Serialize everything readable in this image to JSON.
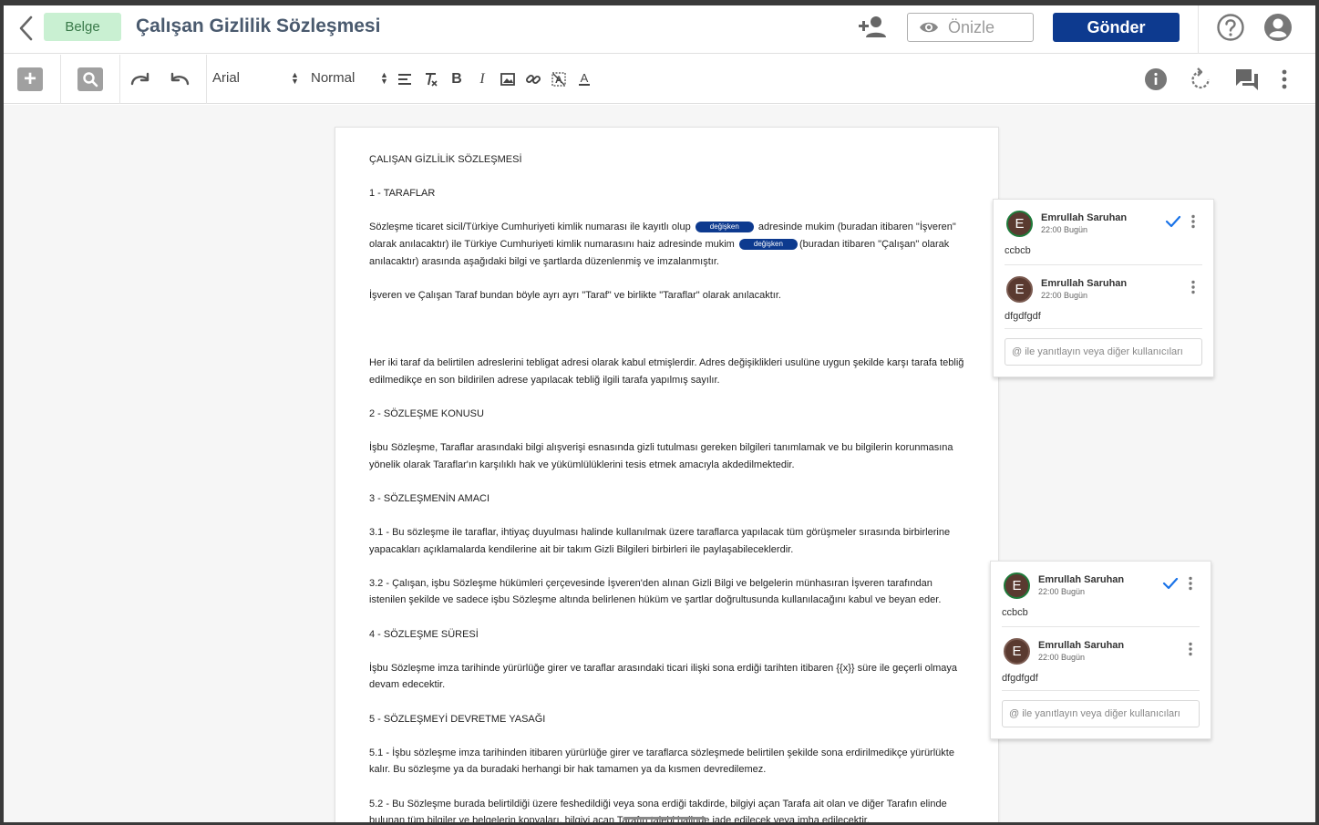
{
  "header": {
    "badge": "Belge",
    "title": "Çalışan Gizlilik Sözleşmesi",
    "preview_label": "Önizle",
    "send_label": "Gönder"
  },
  "toolbar": {
    "font": "Arial",
    "style": "Normal"
  },
  "document": {
    "heading": "ÇALIŞAN GİZLİLİK SÖZLEŞMESİ",
    "s1_title": "1 - TARAFLAR",
    "p1_a": "Sözleşme ticaret sicil/Türkiye Cumhuriyeti kimlik numarası ile kayıtlı olup",
    "chip1": "değişken",
    "p1_b": "adresinde mukim  (buradan  itibaren \"İşveren\" olarak anılacaktır)  ile   Türkiye Cumhuriyeti kimlik numarasını haiz  adresinde mukim",
    "chip2": "değişken",
    "p1_c": "(buradan itibaren \"Çalışan\" olarak anılacaktır) arasında aşağıdaki bilgi ve şartlarda düzenlenmiş ve imzalanmıştır.",
    "p2": "İşveren ve Çalışan Taraf bundan böyle ayrı ayrı \"Taraf\" ve birlikte \"Taraflar\" olarak anılacaktır.",
    "p3": "Her iki taraf da belirtilen adreslerini tebligat adresi olarak kabul etmişlerdir. Adres değişiklikleri usulüne uygun şekilde karşı tarafa tebliğ edilmedikçe en son bildirilen adrese yapılacak tebliğ ilgili tarafa yapılmış sayılır.",
    "s2_title": "2 - SÖZLEŞME KONUSU",
    "p4": "İşbu Sözleşme, Taraflar arasındaki bilgi alışverişi esnasında gizli tutulması gereken bilgileri tanımlamak ve bu bilgilerin korunmasına yönelik olarak Taraflar'ın karşılıklı hak ve yükümlülüklerini tesis etmek amacıyla akdedilmektedir.",
    "s3_title": "3 - SÖZLEŞMENİN AMACI",
    "p5": "3.1 - Bu sözleşme ile taraflar, ihtiyaç duyulması halinde kullanılmak üzere taraflarca yapılacak tüm görüşmeler sırasında birbirlerine yapacakları açıklamalarda kendilerine ait bir takım Gizli Bilgileri birbirleri ile paylaşabileceklerdir.",
    "p6": "3.2 - Çalışan, işbu Sözleşme hükümleri çerçevesinde İşveren'den alınan Gizli Bilgi ve belgelerin münhasıran İşveren tarafından istenilen şekilde ve sadece işbu Sözleşme altında belirlenen hüküm ve şartlar doğrultusunda kullanılacağını kabul ve beyan eder.",
    "s4_title": "4 - SÖZLEŞME SÜRESİ",
    "p7": "İşbu Sözleşme imza tarihinde yürürlüğe girer ve taraflar arasındaki ticari ilişki sona erdiği tarihten itibaren {{x}} süre ile geçerli olmaya devam edecektir.",
    "s5_title": "5 - SÖZLEŞMEYİ DEVRETME YASAĞI",
    "p8": "5.1 - İşbu sözleşme imza tarihinden itibaren yürürlüğe girer ve taraflarca sözleşmede belirtilen şekilde sona erdirilmedikçe yürürlükte kalır. Bu sözleşme ya da buradaki herhangi bir hak tamamen ya da kısmen devredilemez.",
    "p9": "5.2 - Bu Sözleşme burada belirtildiği üzere feshedildiği veya sona erdiği takdirde, bilgiyi açan Tarafa ait olan ve diğer Tarafın elinde bulunan tüm bilgiler ve belgelerin kopyaları, bilgiyi açan Tarafın talebi halinde iade edilecek veya imha edilecektir."
  },
  "comment_threads": [
    {
      "comments": [
        {
          "avatar": "E",
          "author": "Emrullah Saruhan",
          "time": "22:00 Bugün",
          "text": "ccbcb"
        },
        {
          "avatar": "E",
          "author": "Emrullah Saruhan",
          "time": "22:00 Bugün",
          "text": "dfgdfgdf"
        }
      ],
      "reply_placeholder": "@ ile yanıtlayın veya diğer kullanıcıları"
    },
    {
      "comments": [
        {
          "avatar": "E",
          "author": "Emrullah Saruhan",
          "time": "22:00 Bugün",
          "text": "ccbcb"
        },
        {
          "avatar": "E",
          "author": "Emrullah Saruhan",
          "time": "22:00 Bugün",
          "text": "dfgdfgdf"
        }
      ],
      "reply_placeholder": "@ ile yanıtlayın veya diğer kullanıcıları"
    }
  ],
  "colors": {
    "primary": "#0d3a8f",
    "badge_bg": "#c9f0d2",
    "resolve_check": "#1a73e8"
  }
}
